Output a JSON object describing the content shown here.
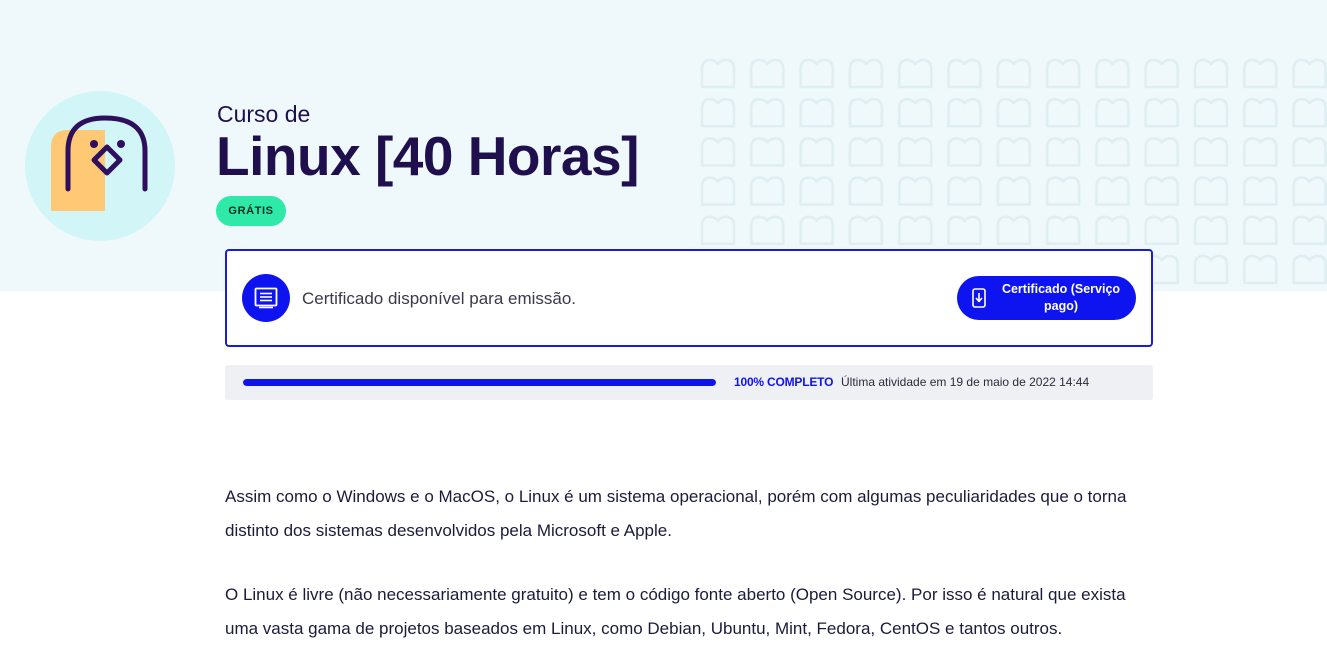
{
  "course": {
    "prefix": "Curso de",
    "title": "Linux [40 Horas]",
    "badge": "GRÁTIS",
    "logo_icon": "linux-penguin-icon"
  },
  "certificate": {
    "message": "Certificado disponível para emissão.",
    "button_label": "Certificado (Serviço pago)",
    "icon": "certificate-icon",
    "button_icon": "download-icon"
  },
  "progress": {
    "percent": 100,
    "percent_label": "100% COMPLETO",
    "last_activity": "Última atividade em 19 de maio de 2022 14:44"
  },
  "description": {
    "paragraphs": [
      "Assim como o Windows e o MacOS, o Linux é um sistema operacional, porém com algumas peculiaridades que o torna distinto dos sistemas desenvolvidos pela Microsoft e Apple.",
      "O Linux é livre (não necessariamente gratuito) e tem o código fonte aberto (Open Source). Por isso é natural que exista uma vasta gama de projetos baseados em Linux, como Debian, Ubuntu, Mint, Fedora, CentOS e tantos outros."
    ]
  },
  "colors": {
    "primary": "#0d14f0",
    "title": "#1f0f4d",
    "badge": "#2fe9a8",
    "hero_bg": "#eff9fb",
    "logo_circle": "#d2f5f7",
    "logo_accent": "#ffc875"
  }
}
